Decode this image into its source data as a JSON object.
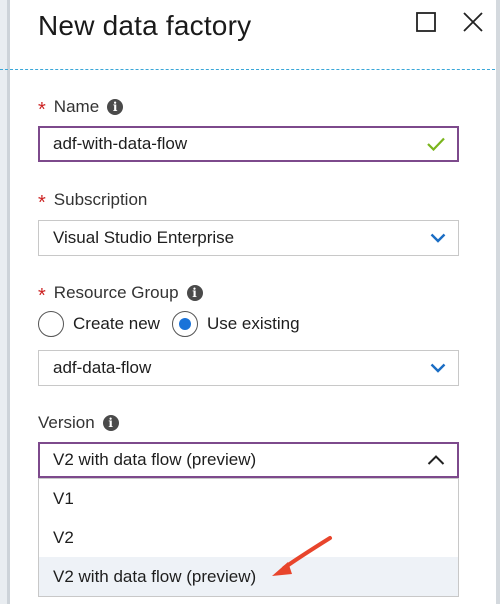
{
  "panel": {
    "title": "New data factory"
  },
  "name_field": {
    "label": "Name",
    "required_mark": "*",
    "value": "adf-with-data-flow"
  },
  "subscription_field": {
    "label": "Subscription",
    "required_mark": "*",
    "value": "Visual Studio Enterprise"
  },
  "resource_group_field": {
    "label": "Resource Group",
    "required_mark": "*",
    "options": [
      {
        "label": "Create new",
        "selected": false
      },
      {
        "label": "Use existing",
        "selected": true
      }
    ],
    "value": "adf-data-flow"
  },
  "version_field": {
    "label": "Version",
    "value": "V2 with data flow (preview)",
    "dropdown_options": [
      "V1",
      "V2",
      "V2 with data flow (preview)"
    ]
  },
  "colors": {
    "accent_border": "#7d4a8c",
    "valid_check": "#7ab51d",
    "chevron_blue": "#1a6dc4",
    "radio_selected": "#1a73d9",
    "annotation_arrow": "#e8452c",
    "dashed_divider": "#3aa7d8"
  }
}
